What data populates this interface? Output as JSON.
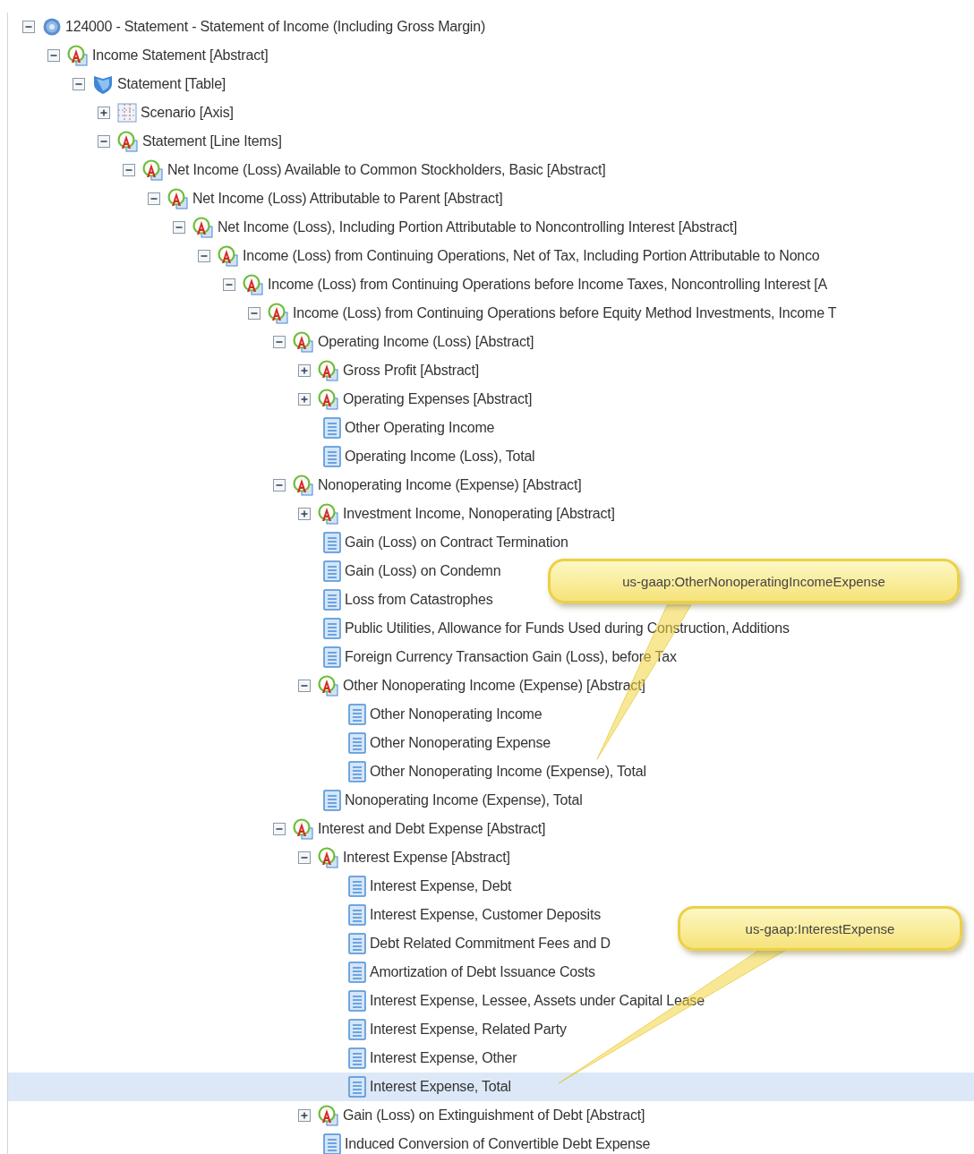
{
  "tree": {
    "label": "124000 - Statement - Statement of Income (Including Gross Margin)",
    "kind": "gear",
    "expanded": true,
    "selected": false,
    "children": [
      {
        "label": "Income Statement [Abstract]",
        "kind": "abstract",
        "expanded": true,
        "selected": false,
        "children": [
          {
            "label": "Statement [Table]",
            "kind": "table",
            "expanded": true,
            "selected": false,
            "children": [
              {
                "label": "Scenario [Axis]",
                "kind": "axis",
                "expanded": false,
                "selected": false
              },
              {
                "label": "Statement [Line Items]",
                "kind": "abstract",
                "expanded": true,
                "selected": false,
                "children": [
                  {
                    "label": "Net Income (Loss) Available to Common Stockholders, Basic [Abstract]",
                    "kind": "abstract",
                    "expanded": true,
                    "selected": false,
                    "children": [
                      {
                        "label": "Net Income (Loss) Attributable to Parent [Abstract]",
                        "kind": "abstract",
                        "expanded": true,
                        "selected": false,
                        "children": [
                          {
                            "label": "Net Income (Loss), Including Portion Attributable to Noncontrolling Interest [Abstract]",
                            "kind": "abstract",
                            "expanded": true,
                            "selected": false,
                            "children": [
                              {
                                "label": "Income (Loss) from Continuing Operations, Net of Tax, Including Portion Attributable to Nonco",
                                "kind": "abstract",
                                "expanded": true,
                                "selected": false,
                                "children": [
                                  {
                                    "label": "Income (Loss) from Continuing Operations before Income Taxes, Noncontrolling Interest [A",
                                    "kind": "abstract",
                                    "expanded": true,
                                    "selected": false,
                                    "children": [
                                      {
                                        "label": "Income (Loss) from Continuing Operations before Equity Method Investments, Income T",
                                        "kind": "abstract",
                                        "expanded": true,
                                        "selected": false,
                                        "children": [
                                          {
                                            "label": "Operating Income (Loss) [Abstract]",
                                            "kind": "abstract",
                                            "expanded": true,
                                            "selected": false,
                                            "children": [
                                              {
                                                "label": "Gross Profit [Abstract]",
                                                "kind": "abstract",
                                                "expanded": false,
                                                "selected": false
                                              },
                                              {
                                                "label": "Operating Expenses [Abstract]",
                                                "kind": "abstract",
                                                "expanded": false,
                                                "selected": false
                                              },
                                              {
                                                "label": "Other Operating Income",
                                                "kind": "item",
                                                "selected": false
                                              },
                                              {
                                                "label": "Operating Income (Loss), Total",
                                                "kind": "item",
                                                "selected": false
                                              }
                                            ]
                                          },
                                          {
                                            "label": "Nonoperating Income (Expense) [Abstract]",
                                            "kind": "abstract",
                                            "expanded": true,
                                            "selected": false,
                                            "children": [
                                              {
                                                "label": "Investment Income, Nonoperating [Abstract]",
                                                "kind": "abstract",
                                                "expanded": false,
                                                "selected": false
                                              },
                                              {
                                                "label": "Gain (Loss) on Contract Termination",
                                                "kind": "item",
                                                "selected": false
                                              },
                                              {
                                                "label": "Gain (Loss) on Condemn",
                                                "kind": "item",
                                                "selected": false
                                              },
                                              {
                                                "label": "Loss from Catastrophes",
                                                "kind": "item",
                                                "selected": false
                                              },
                                              {
                                                "label": "Public Utilities, Allowance for Funds Used during Construction, Additions",
                                                "kind": "item",
                                                "selected": false
                                              },
                                              {
                                                "label": "Foreign Currency Transaction Gain (Loss), before Tax",
                                                "kind": "item",
                                                "selected": false
                                              },
                                              {
                                                "label": "Other Nonoperating Income (Expense) [Abstract]",
                                                "kind": "abstract",
                                                "expanded": true,
                                                "selected": false,
                                                "children": [
                                                  {
                                                    "label": "Other Nonoperating Income",
                                                    "kind": "item",
                                                    "selected": false
                                                  },
                                                  {
                                                    "label": "Other Nonoperating Expense",
                                                    "kind": "item",
                                                    "selected": false
                                                  },
                                                  {
                                                    "label": "Other Nonoperating Income (Expense), Total",
                                                    "kind": "item",
                                                    "selected": false
                                                  }
                                                ]
                                              },
                                              {
                                                "label": "Nonoperating Income (Expense), Total",
                                                "kind": "item",
                                                "selected": false
                                              }
                                            ]
                                          },
                                          {
                                            "label": "Interest and Debt Expense [Abstract]",
                                            "kind": "abstract",
                                            "expanded": true,
                                            "selected": false,
                                            "children": [
                                              {
                                                "label": "Interest Expense [Abstract]",
                                                "kind": "abstract",
                                                "expanded": true,
                                                "selected": false,
                                                "children": [
                                                  {
                                                    "label": "Interest Expense, Debt",
                                                    "kind": "item",
                                                    "selected": false
                                                  },
                                                  {
                                                    "label": "Interest Expense, Customer Deposits",
                                                    "kind": "item",
                                                    "selected": false
                                                  },
                                                  {
                                                    "label": "Debt Related Commitment Fees and D",
                                                    "kind": "item",
                                                    "selected": false
                                                  },
                                                  {
                                                    "label": "Amortization of Debt Issuance Costs",
                                                    "kind": "item",
                                                    "selected": false
                                                  },
                                                  {
                                                    "label": "Interest Expense, Lessee, Assets under Capital Lease",
                                                    "kind": "item",
                                                    "selected": false
                                                  },
                                                  {
                                                    "label": "Interest Expense, Related Party",
                                                    "kind": "item",
                                                    "selected": false
                                                  },
                                                  {
                                                    "label": "Interest Expense, Other",
                                                    "kind": "item",
                                                    "selected": false
                                                  },
                                                  {
                                                    "label": "Interest Expense, Total",
                                                    "kind": "item",
                                                    "selected": true
                                                  }
                                                ]
                                              },
                                              {
                                                "label": "Gain (Loss) on Extinguishment of Debt [Abstract]",
                                                "kind": "abstract",
                                                "expanded": false,
                                                "selected": false
                                              },
                                              {
                                                "label": "Induced Conversion of Convertible Debt Expense",
                                                "kind": "item",
                                                "selected": false
                                              }
                                            ]
                                          }
                                        ]
                                      }
                                    ]
                                  }
                                ]
                              }
                            ]
                          }
                        ]
                      }
                    ]
                  }
                ]
              }
            ]
          }
        ]
      }
    ]
  },
  "callouts": [
    {
      "text": "us-gaap:OtherNonoperatingIncomeExpense"
    },
    {
      "text": "us-gaap:InterestExpense"
    }
  ]
}
